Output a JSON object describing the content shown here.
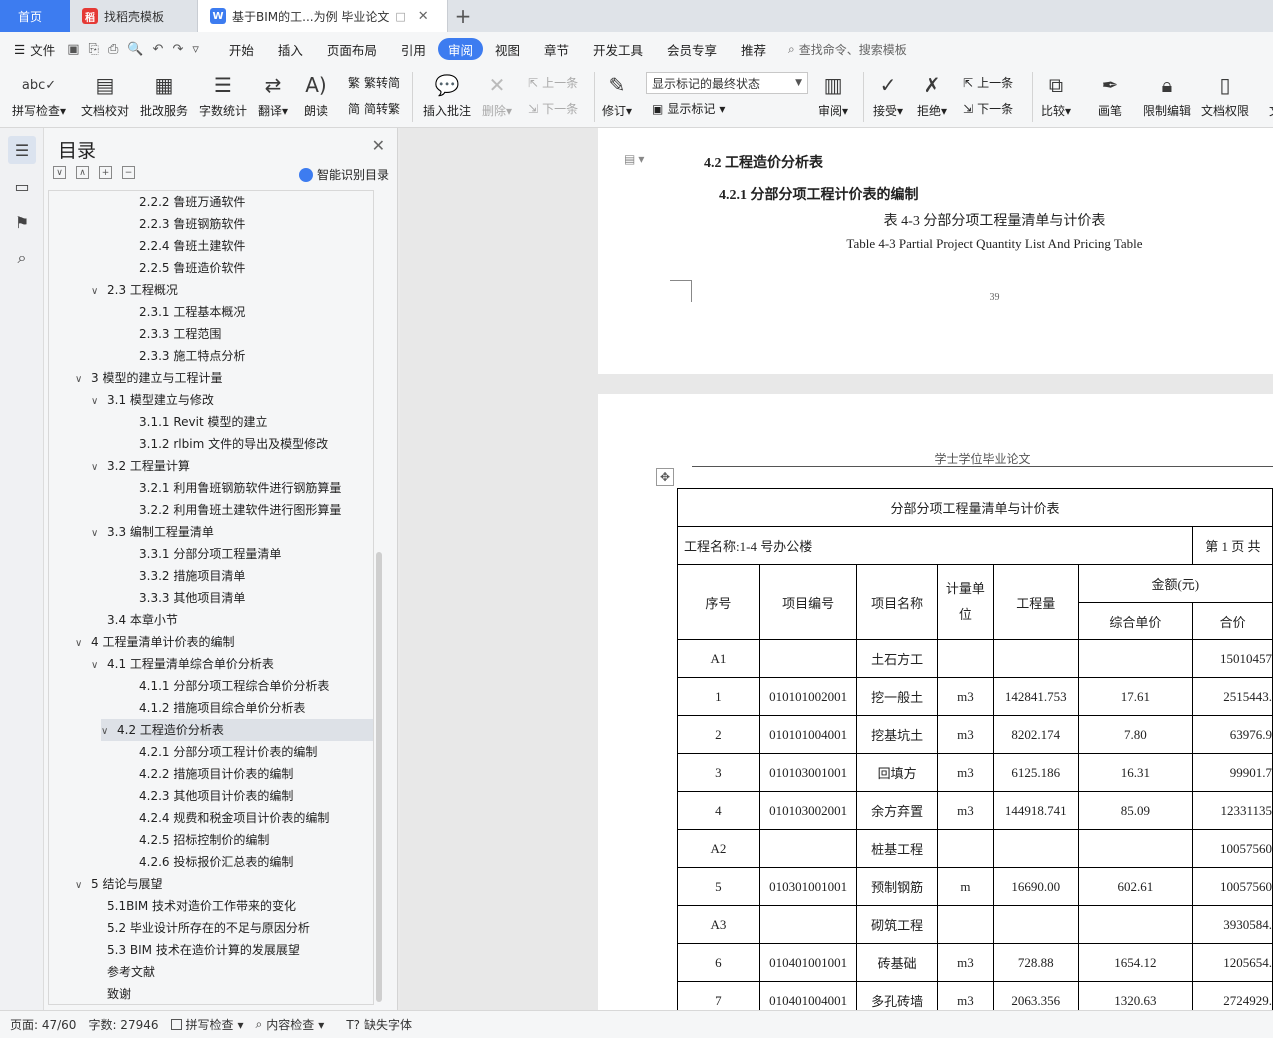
{
  "tabs": {
    "home": "首页",
    "template": "找稻壳模板",
    "doc": "基于BIM的工...为例 毕业论文"
  },
  "menu": {
    "file": "文件",
    "items": [
      "开始",
      "插入",
      "页面布局",
      "引用",
      "审阅",
      "视图",
      "章节",
      "开发工具",
      "会员专享",
      "推荐"
    ],
    "active": "审阅",
    "search": "查找命令、搜索模板"
  },
  "ribbon": {
    "spell": "拼写检查",
    "proof": "文档校对",
    "annotate_service": "批改服务",
    "word_count": "字数统计",
    "translate": "翻译",
    "read_aloud": "朗读",
    "to_traditional": "繁转简",
    "to_simplified": "简转繁",
    "insert_comment": "插入批注",
    "delete": "删除",
    "prev_comment": "上一条",
    "next_comment": "下一条",
    "revise": "修订",
    "markup_state": "显示标记的最终状态",
    "show_markup": "显示标记",
    "review": "审阅",
    "accept": "接受",
    "reject": "拒绝",
    "prev_change": "上一条",
    "next_change": "下一条",
    "compare": "比较",
    "pen": "画笔",
    "restrict": "限制编辑",
    "doc_rights": "文档权限",
    "more": "文"
  },
  "toc": {
    "title": "目录",
    "ai": "智能识别目录",
    "items": [
      {
        "label": "2.2.2 鲁班万通软件",
        "level": 3
      },
      {
        "label": "2.2.3 鲁班钢筋软件",
        "level": 3
      },
      {
        "label": "2.2.4 鲁班土建软件",
        "level": 3
      },
      {
        "label": "2.2.5 鲁班造价软件",
        "level": 3
      },
      {
        "label": "2.3 工程概况",
        "level": 2,
        "chev": "∨"
      },
      {
        "label": "2.3.1 工程基本概况",
        "level": 3
      },
      {
        "label": "2.3.3 工程范围",
        "level": 3
      },
      {
        "label": "2.3.3 施工特点分析",
        "level": 3
      },
      {
        "label": "3 模型的建立与工程计量",
        "level": 1,
        "chev": "∨"
      },
      {
        "label": "3.1 模型建立与修改",
        "level": 2,
        "chev": "∨"
      },
      {
        "label": "3.1.1 Revit  模型的建立",
        "level": 3
      },
      {
        "label": "3.1.2 rlbim 文件的导出及模型修改",
        "level": 3
      },
      {
        "label": "3.2 工程量计算",
        "level": 2,
        "chev": "∨"
      },
      {
        "label": "3.2.1 利用鲁班钢筋软件进行钢筋算量",
        "level": 3
      },
      {
        "label": "3.2.2 利用鲁班土建软件进行图形算量",
        "level": 3
      },
      {
        "label": "3.3 编制工程量清单",
        "level": 2,
        "chev": "∨"
      },
      {
        "label": "3.3.1 分部分项工程量清单",
        "level": 3
      },
      {
        "label": "3.3.2 措施项目清单",
        "level": 3
      },
      {
        "label": "3.3.3 其他项目清单",
        "level": 3
      },
      {
        "label": "3.4 本章小节",
        "level": 2
      },
      {
        "label": "4 工程量清单计价表的编制",
        "level": 1,
        "chev": "∨"
      },
      {
        "label": "4.1 工程量清单综合单价分析表",
        "level": 2,
        "chev": "∨"
      },
      {
        "label": "4.1.1 分部分项工程综合单价分析表",
        "level": 3
      },
      {
        "label": "4.1.2 措施项目综合单价分析表",
        "level": 3
      },
      {
        "label": "4.2 工程造价分析表",
        "level": 2,
        "chev": "∨",
        "selected": true
      },
      {
        "label": "4.2.1 分部分项工程计价表的编制",
        "level": 3
      },
      {
        "label": "4.2.2 措施项目计价表的编制",
        "level": 3
      },
      {
        "label": "4.2.3 其他项目计价表的编制",
        "level": 3
      },
      {
        "label": "4.2.4 规费和税金项目计价表的编制",
        "level": 3
      },
      {
        "label": "4.2.5 招标控制价的编制",
        "level": 3
      },
      {
        "label": "4.2.6 投标报价汇总表的编制",
        "level": 3
      },
      {
        "label": "5 结论与展望",
        "level": 1,
        "chev": "∨"
      },
      {
        "label": "5.1BIM 技术对造价工作带来的变化",
        "level": 2
      },
      {
        "label": "5.2 毕业设计所存在的不足与原因分析",
        "level": 2
      },
      {
        "label": "5.3 BIM 技术在造价计算的发展展望",
        "level": 2
      },
      {
        "label": "参考文献",
        "level": 0
      },
      {
        "label": "致谢",
        "level": 0
      }
    ]
  },
  "doc": {
    "section": "4.2 工程造价分析表",
    "subsection": "4.2.1 分部分项工程计价表的编制",
    "caption_zh": "表 4-3 分部分项工程量清单与计价表",
    "caption_en": "Table 4-3 Partial Project Quantity List And Pricing Table",
    "page_number": "39",
    "page_header": "学士学位毕业论文",
    "table": {
      "title": "分部分项工程量清单与计价表",
      "project": "工程名称:1-4 号办公楼",
      "page": "第 1 页  共",
      "headers": {
        "seq": "序号",
        "code": "项目编号",
        "name": "项目名称",
        "unit": "计量单位",
        "qty": "工程量",
        "amount": "金额(元)",
        "unit_price": "综合单价",
        "total": "合价"
      },
      "rows": [
        [
          "A1",
          "",
          "土石方工",
          "",
          "",
          "",
          "15010457"
        ],
        [
          "1",
          "010101002001",
          "挖一般土",
          "m3",
          "142841.753",
          "17.61",
          "2515443."
        ],
        [
          "2",
          "010101004001",
          "挖基坑土",
          "m3",
          "8202.174",
          "7.80",
          "63976.9"
        ],
        [
          "3",
          "010103001001",
          "回填方",
          "m3",
          "6125.186",
          "16.31",
          "99901.7"
        ],
        [
          "4",
          "010103002001",
          "余方弃置",
          "m3",
          "144918.741",
          "85.09",
          "12331135"
        ],
        [
          "A2",
          "",
          "桩基工程",
          "",
          "",
          "",
          "10057560"
        ],
        [
          "5",
          "010301001001",
          "预制钢筋",
          "m",
          "16690.00",
          "602.61",
          "10057560"
        ],
        [
          "A3",
          "",
          "砌筑工程",
          "",
          "",
          "",
          "3930584."
        ],
        [
          "6",
          "010401001001",
          "砖基础",
          "m3",
          "728.88",
          "1654.12",
          "1205654."
        ],
        [
          "7",
          "010401004001",
          "多孔砖墙",
          "m3",
          "2063.356",
          "1320.63",
          "2724929."
        ]
      ]
    }
  },
  "status": {
    "page": "页面: 47/60",
    "words": "字数: 27946",
    "spell": "拼写检查",
    "content": "内容检查",
    "missing_font": "缺失字体"
  },
  "colors": {
    "accent": "#3d7cf0",
    "wps_red": "#e53935"
  }
}
